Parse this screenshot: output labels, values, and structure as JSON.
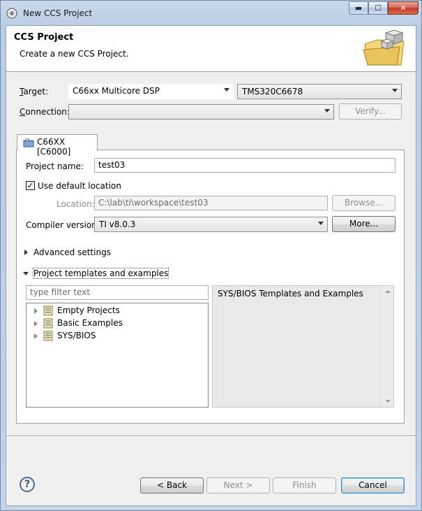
{
  "window": {
    "title": "New CCS Project",
    "controls": {
      "minimize": "▬",
      "maximize": "☐",
      "close": "✕"
    }
  },
  "header": {
    "title": "CCS Project",
    "description": "Create a new CCS Project.",
    "icon": "folder-cube-icon"
  },
  "target": {
    "label": "Target:",
    "family": "C66xx Multicore DSP",
    "device": "TMS320C6678"
  },
  "connection": {
    "label": "Connection:",
    "value": "",
    "verify_label": "Verify..."
  },
  "tab": {
    "label": "C66XX [C6000]"
  },
  "project_name": {
    "label": "Project name:",
    "value": "test03"
  },
  "default_location": {
    "label": "Use default location",
    "checked": true,
    "check_glyph": "✓"
  },
  "location": {
    "label": "Location:",
    "value": "C:\\lab\\ti\\workspace\\test03",
    "browse_label": "Browse..."
  },
  "compiler": {
    "label": "Compiler version:",
    "value": "TI v8.0.3",
    "more_label": "More..."
  },
  "advanced": {
    "label": "Advanced settings",
    "expanded": false
  },
  "templates": {
    "label": "Project templates and examples",
    "expanded": true,
    "filter_placeholder": "type filter text",
    "items": [
      {
        "label": "Empty Projects"
      },
      {
        "label": "Basic Examples"
      },
      {
        "label": "SYS/BIOS"
      }
    ],
    "description": "SYS/BIOS Templates and Examples"
  },
  "footer": {
    "help": "?",
    "back": "< Back",
    "next": "Next >",
    "finish": "Finish",
    "cancel": "Cancel"
  },
  "colors": {
    "accent": "#3c7fb1",
    "titlebar": "#c9d9ea",
    "close_button": "#c2391f"
  }
}
